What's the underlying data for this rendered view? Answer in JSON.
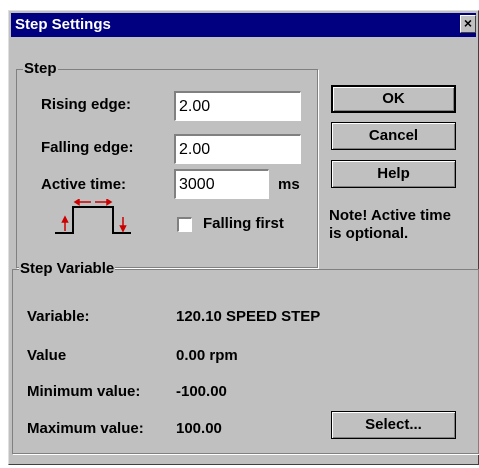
{
  "window": {
    "title": "Step Settings",
    "close_glyph": "×"
  },
  "step_group": {
    "legend": "Step",
    "rising_edge_label": "Rising edge:",
    "rising_edge_value": "2.00",
    "falling_edge_label": "Falling edge:",
    "falling_edge_value": "2.00",
    "active_time_label": "Active time:",
    "active_time_value": "3000",
    "active_time_unit": "ms",
    "falling_first_label": "Falling first",
    "falling_first_checked": false
  },
  "buttons": {
    "ok": "OK",
    "cancel": "Cancel",
    "help": "Help",
    "select": "Select..."
  },
  "note": {
    "line1": "Note! Active time",
    "line2": "is optional."
  },
  "variable_group": {
    "legend": "Step Variable",
    "rows": [
      {
        "label": "Variable:",
        "value": "120.10 SPEED STEP"
      },
      {
        "label": "Value",
        "value": "0.00 rpm"
      },
      {
        "label": "Minimum value:",
        "value": "-100.00"
      },
      {
        "label": "Maximum value:",
        "value": "100.00"
      }
    ]
  },
  "colors": {
    "titlebar": "#000080",
    "face": "#c0c0c0",
    "step_arrows": "#cc0000"
  }
}
